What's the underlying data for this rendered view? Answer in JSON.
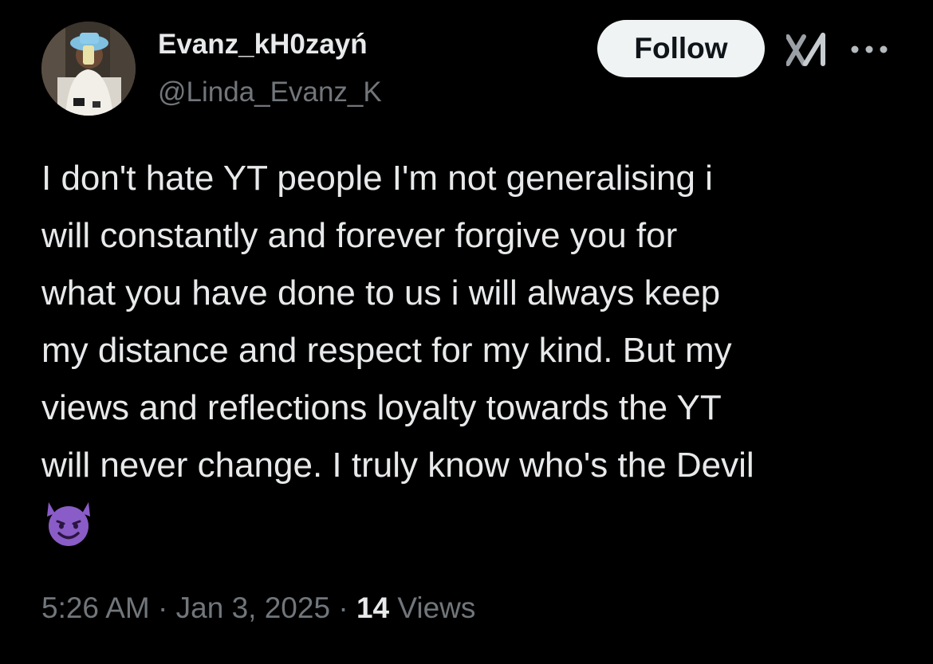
{
  "user": {
    "display_name": "Evanz_kH0zayń",
    "handle": "@Linda_Evanz_K"
  },
  "header": {
    "follow_label": "Follow",
    "icons": [
      "grok-icon",
      "more-icon"
    ]
  },
  "tweet": {
    "text": "I don't hate YT people I'm not generalising i\nwill constantly and forever forgive you for\nwhat you have done to us i will always keep\nmy distance and respect for my kind. But my\nviews and reflections loyalty towards the YT\nwill never change. I truly know who's the Devil",
    "emoji": "smiling-face-with-horns"
  },
  "meta": {
    "time": "5:26 AM",
    "separator": "·",
    "date": "Jan 3, 2025",
    "views_count": "14",
    "views_label": "Views"
  },
  "colors": {
    "background": "#000000",
    "primary_text": "#e7e9ea",
    "secondary_text": "#71767b",
    "follow_bg": "#eff3f4",
    "follow_text": "#0f1419",
    "emoji": "#8a5cc7"
  }
}
